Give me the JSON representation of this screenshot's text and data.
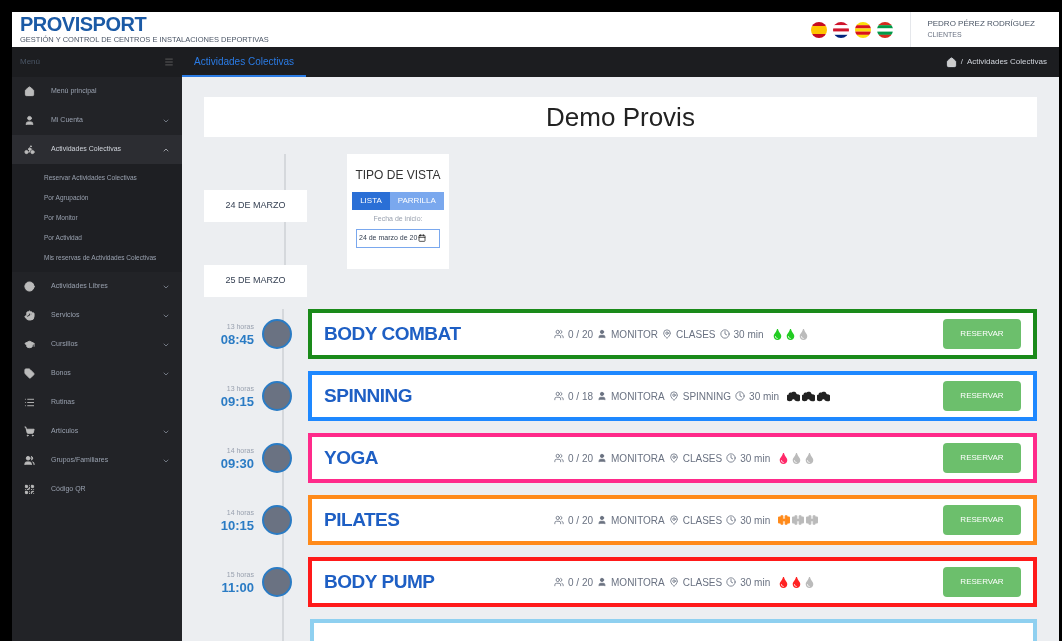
{
  "header": {
    "logo": "PROVISPORT",
    "logo_tagline": "GESTIÓN Y CONTROL DE CENTROS E INSTALACIONES DEPORTIVAS",
    "user_name": "PEDRO PÉREZ RODRÍGUEZ",
    "user_role": "CLIENTES"
  },
  "sidebar": {
    "title": "Menú",
    "items": [
      {
        "label": "Menú principal",
        "expandable": false,
        "expanded": false
      },
      {
        "label": "Mi Cuenta",
        "expandable": true,
        "expanded": false
      },
      {
        "label": "Actividades Colectivas",
        "expandable": true,
        "expanded": true,
        "children": [
          {
            "label": "Reservar Actividades Colectivas"
          },
          {
            "label": "Por Agrupación"
          },
          {
            "label": "Por Monitor"
          },
          {
            "label": "Por Actividad"
          },
          {
            "label": "Mis reservas de Actividades Colectivas"
          }
        ]
      },
      {
        "label": "Actividades Libres",
        "expandable": true,
        "expanded": false
      },
      {
        "label": "Servicios",
        "expandable": true,
        "expanded": false
      },
      {
        "label": "Cursillos",
        "expandable": true,
        "expanded": false
      },
      {
        "label": "Bonos",
        "expandable": true,
        "expanded": false
      },
      {
        "label": "Rutinas",
        "expandable": false,
        "expanded": false
      },
      {
        "label": "Artículos",
        "expandable": true,
        "expanded": false
      },
      {
        "label": "Grupos/Familiares",
        "expandable": true,
        "expanded": false
      },
      {
        "label": "Código QR",
        "expandable": false,
        "expanded": false
      }
    ]
  },
  "tab": {
    "label": "Actividades Colectivas",
    "selected": true
  },
  "breadcrumb": {
    "separator": "/",
    "current": "Actividades Colectivas"
  },
  "page_title": "Demo Provis",
  "view_panel": {
    "title": "TIPO DE VISTA",
    "options": [
      {
        "label": "LISTA",
        "selected": true
      },
      {
        "label": "PARRILLA",
        "selected": false
      }
    ],
    "date_label": "Fecha de inicio:",
    "date_value": "24 de marzo de 20"
  },
  "dates": [
    "24 DE MARZO",
    "25 DE MARZO"
  ],
  "activities": [
    {
      "hours": "13 horas",
      "time": "08:45",
      "title": "BODY COMBAT",
      "color": "#1a8a1a",
      "capacity": "0 / 20",
      "monitor": "MONITOR",
      "place": "CLASES",
      "duration": "30 min",
      "kind": "drop",
      "intensity": {
        "color": "#22cc22",
        "stars": 2
      },
      "button": "RESERVAR"
    },
    {
      "hours": "13 horas",
      "time": "09:15",
      "title": "SPINNING",
      "color": "#1e88ff",
      "capacity": "0 / 18",
      "monitor": "MONITORA",
      "place": "SPINNING",
      "duration": "30 min",
      "kind": "bike",
      "intensity": {
        "color": "#222222",
        "stars": 3
      },
      "button": "RESERVAR"
    },
    {
      "hours": "14 horas",
      "time": "09:30",
      "title": "YOGA",
      "color": "#ff2a8a",
      "capacity": "0 / 20",
      "monitor": "MONITORA",
      "place": "CLASES",
      "duration": "30 min",
      "kind": "drop",
      "intensity": {
        "color": "#ff2a6a",
        "stars": 1
      },
      "button": "RESERVAR"
    },
    {
      "hours": "14 horas",
      "time": "10:15",
      "title": "PILATES",
      "color": "#ff8a1a",
      "capacity": "0 / 20",
      "monitor": "MONITORA",
      "place": "CLASES",
      "duration": "30 min",
      "kind": "dumbbell",
      "intensity": {
        "color": "#ff8a1a",
        "stars": 1
      },
      "button": "RESERVAR"
    },
    {
      "hours": "15 horas",
      "time": "11:00",
      "title": "BODY PUMP",
      "color": "#ff1a1a",
      "capacity": "0 / 20",
      "monitor": "MONITORA",
      "place": "CLASES",
      "duration": "30 min",
      "kind": "drop",
      "intensity": {
        "color": "#ff2222",
        "stars": 2
      },
      "button": "RESERVAR"
    }
  ],
  "next_activity": {
    "color": "#8fd0f0"
  }
}
